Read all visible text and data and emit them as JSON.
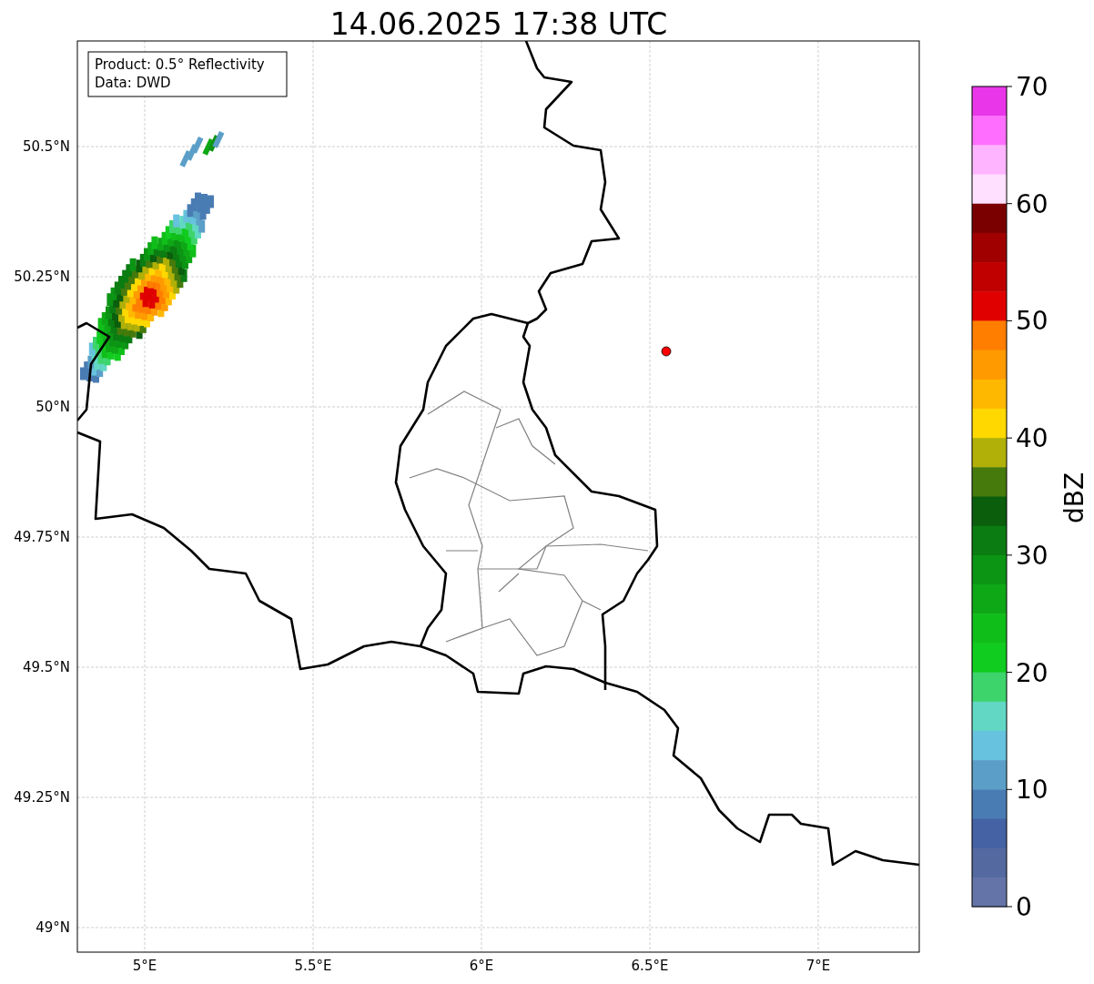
{
  "title": "14.06.2025 17:38 UTC",
  "info_box": [
    "Product: 0.5° Reflectivity",
    "Data: DWD"
  ],
  "map": {
    "xticks": [
      "5°E",
      "5.5°E",
      "6°E",
      "6.5°E",
      "7°E"
    ],
    "yticks": [
      "50.5°N",
      "50.25°N",
      "50°N",
      "49.75°N",
      "49.5°N",
      "49.25°N",
      "49°N"
    ]
  },
  "colorbar": {
    "label": "dBZ",
    "ticks": [
      "70",
      "60",
      "50",
      "40",
      "30",
      "20",
      "10",
      "0"
    ],
    "bins": [
      {
        "color": "#e836e8"
      },
      {
        "color": "#ff6eff"
      },
      {
        "color": "#ffb4ff"
      },
      {
        "color": "#ffe0ff"
      },
      {
        "color": "#7a0000"
      },
      {
        "color": "#a00000"
      },
      {
        "color": "#c00000"
      },
      {
        "color": "#e00000"
      },
      {
        "color": "#ff7e00"
      },
      {
        "color": "#ff9a00"
      },
      {
        "color": "#ffb800"
      },
      {
        "color": "#ffd800"
      },
      {
        "color": "#b0b008"
      },
      {
        "color": "#467a0c"
      },
      {
        "color": "#0a5e0c"
      },
      {
        "color": "#0b7c12"
      },
      {
        "color": "#0c9414"
      },
      {
        "color": "#0ea816"
      },
      {
        "color": "#10be1a"
      },
      {
        "color": "#10cc1e"
      },
      {
        "color": "#3dd46c"
      },
      {
        "color": "#62d8c4"
      },
      {
        "color": "#66c2de"
      },
      {
        "color": "#5b9fc8"
      },
      {
        "color": "#4a7cb4"
      },
      {
        "color": "#4462a4"
      },
      {
        "color": "#5469a0"
      },
      {
        "color": "#6474a8"
      }
    ]
  }
}
